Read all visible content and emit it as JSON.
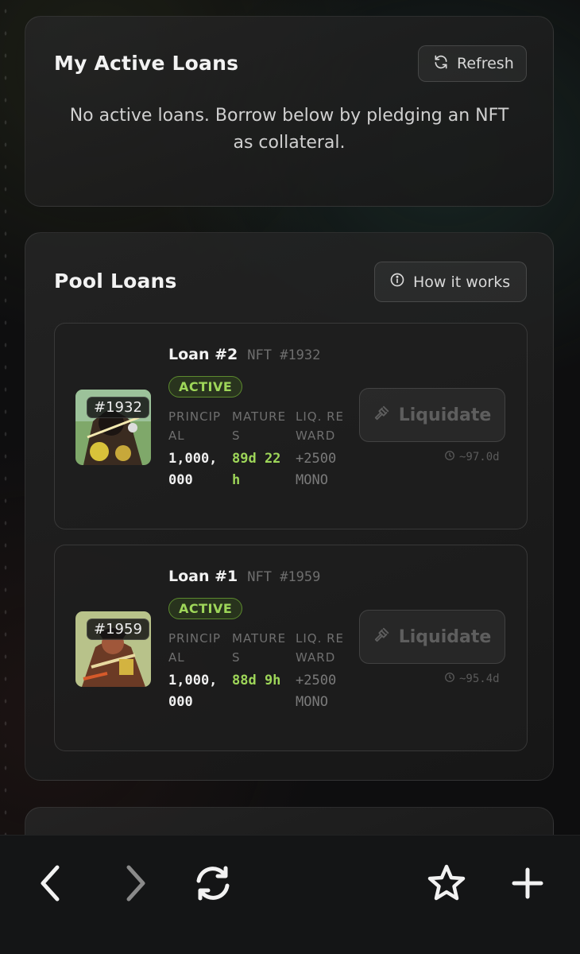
{
  "active_loans": {
    "title": "My Active Loans",
    "refresh_label": "Refresh",
    "empty_message": "No active loans. Borrow below by pledging an NFT as collateral."
  },
  "pool_loans": {
    "title": "Pool Loans",
    "how_it_works_label": "How it works",
    "loans": [
      {
        "name": "Loan #2",
        "nft": "NFT #1932",
        "thumb_tag": "#1932",
        "status": "ACTIVE",
        "principal_label": "PRINCIPAL",
        "principal_value": "1,000,000",
        "matures_label": "MATURES",
        "matures_value": "89d 22h",
        "reward_label": "LIQ. REWARD",
        "reward_value": "+2500 MONO",
        "liquidate_label": "Liquidate",
        "eta": "~97.0d"
      },
      {
        "name": "Loan #1",
        "nft": "NFT #1959",
        "thumb_tag": "#1959",
        "status": "ACTIVE",
        "principal_label": "PRINCIPAL",
        "principal_value": "1,000,000",
        "matures_label": "MATURES",
        "matures_value": "88d 9h",
        "reward_label": "LIQ. REWARD",
        "reward_value": "+2500 MONO",
        "liquidate_label": "Liquidate",
        "eta": "~95.4d"
      }
    ]
  },
  "colors": {
    "accent_green": "#9ed659",
    "background": "#0e0e0f",
    "toolbar": "#141516"
  },
  "toolbar": {
    "icons": [
      "back-icon",
      "forward-icon",
      "refresh-icon",
      "bookmark-star-icon",
      "new-tab-plus-icon"
    ]
  }
}
